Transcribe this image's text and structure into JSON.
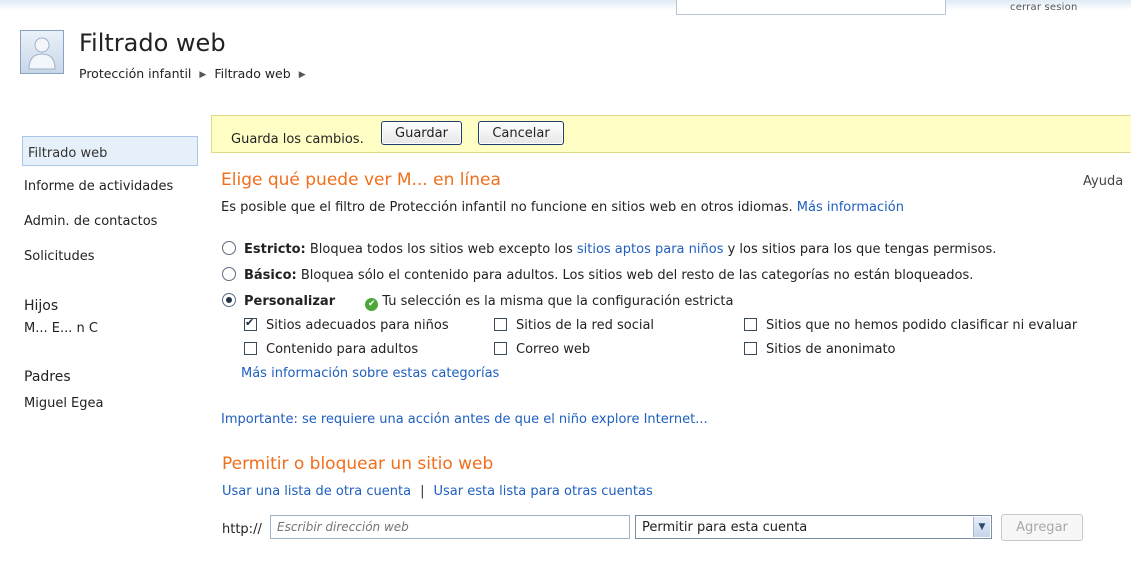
{
  "header": {
    "signout": "cerrar sesion",
    "title": "Filtrado web",
    "breadcrumb": [
      "Protección infantil",
      "Filtrado web"
    ]
  },
  "sidebar": {
    "items": [
      "Filtrado web",
      "Informe de actividades",
      "Admin. de contactos",
      "Solicitudes"
    ],
    "children_heading": "Hijos",
    "children": [
      "M... E... n C"
    ],
    "parents_heading": "Padres",
    "parents": [
      "Miguel Egea"
    ]
  },
  "savebar": {
    "text": "Guarda los cambios.",
    "save_label": "Guardar",
    "cancel_label": "Cancelar"
  },
  "filter": {
    "title": "Elige qué puede ver M... en línea",
    "help": "Ayuda",
    "desc": "Es posible que el filtro de Protección infantil no funcione en sitios web en otros idiomas.",
    "desc_link": "Más información",
    "strict": {
      "label": "Estricto:",
      "text_before": "Bloquea todos los sitios web excepto los",
      "link": "sitios aptos para niños",
      "text_after": "y los sitios para los que tengas permisos."
    },
    "basic": {
      "label": "Básico:",
      "text": "Bloquea sólo el contenido para adultos. Los sitios web del resto de las categorías no están bloqueados."
    },
    "custom": {
      "label": "Personalizar",
      "note": "Tu selección es la misma que la configuración estricta"
    },
    "categories": [
      {
        "label": "Sitios adecuados para niños",
        "checked": true
      },
      {
        "label": "Sitios de la red social",
        "checked": false
      },
      {
        "label": "Sitios que no hemos podido clasificar ni evaluar",
        "checked": false
      },
      {
        "label": "Contenido para adultos",
        "checked": false
      },
      {
        "label": "Correo web",
        "checked": false
      },
      {
        "label": "Sitios de anonimato",
        "checked": false
      }
    ],
    "more_categories": "Más información sobre estas categorías",
    "important": "Importante: se requiere una acción antes de que el niño explore Internet..."
  },
  "allow": {
    "title": "Permitir o bloquear un sitio web",
    "link1": "Usar una lista de otra cuenta",
    "link2": "Usar esta lista para otras cuentas",
    "http_label": "http://",
    "url_placeholder": "Escribir dirección web",
    "select_value": "Permitir para esta cuenta",
    "add_label": "Agregar"
  },
  "colors": {
    "accent_orange": "#f06e1c",
    "link_blue": "#1f5fbf",
    "savebar_yellow": "#ffffc5",
    "sidebar_selected": "#e6f0fa"
  }
}
